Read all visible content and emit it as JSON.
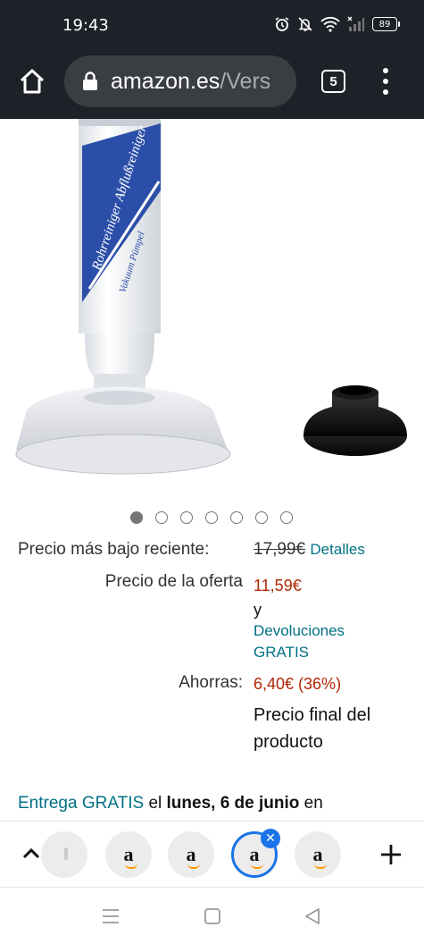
{
  "status_bar": {
    "time": "19:43",
    "battery": "89",
    "icons": [
      "alarm-icon",
      "bell-off-icon",
      "wifi-icon",
      "signal-icon",
      "battery-icon"
    ]
  },
  "browser": {
    "url_domain": "amazon.es",
    "url_path": "/Vers",
    "tab_count": "5"
  },
  "gallery": {
    "dot_count": 7,
    "active_index": 0,
    "product_label_text": "Rohrreiniger Abflußreiniger",
    "product_sub_text": "Vakuum Pümpel"
  },
  "pricing": {
    "recent_low_label": "Precio más bajo reciente:",
    "recent_low_price": "17,99€",
    "details_link": "Detalles",
    "offer_label": "Precio de la oferta",
    "offer_price": "11,59€",
    "and_text": "y",
    "returns_line1": "Devoluciones",
    "returns_line2": "GRATIS",
    "savings_label": "Ahorras:",
    "savings_value": "6,40€ (36%)",
    "final_price_line1": "Precio final del",
    "final_price_line2": "producto"
  },
  "delivery": {
    "free_delivery": "Entrega GRATIS",
    "el": "el",
    "date": "lunes, 6 de junio",
    "en": "en"
  },
  "tab_strip": {
    "tabs": [
      {
        "name": "tab-1",
        "logo": "a",
        "active": false
      },
      {
        "name": "tab-2",
        "logo": "a",
        "active": false
      },
      {
        "name": "tab-3",
        "logo": "a",
        "active": false
      },
      {
        "name": "tab-4",
        "logo": "a",
        "active": true
      },
      {
        "name": "tab-5",
        "logo": "a",
        "active": false
      }
    ],
    "close_symbol": "✕",
    "colors": {
      "active_ring": "#1a73e8",
      "logo_smile": "#ff9900"
    }
  },
  "colors": {
    "top_bar": "#1e2228",
    "link": "#007185",
    "price": "#b12704"
  }
}
